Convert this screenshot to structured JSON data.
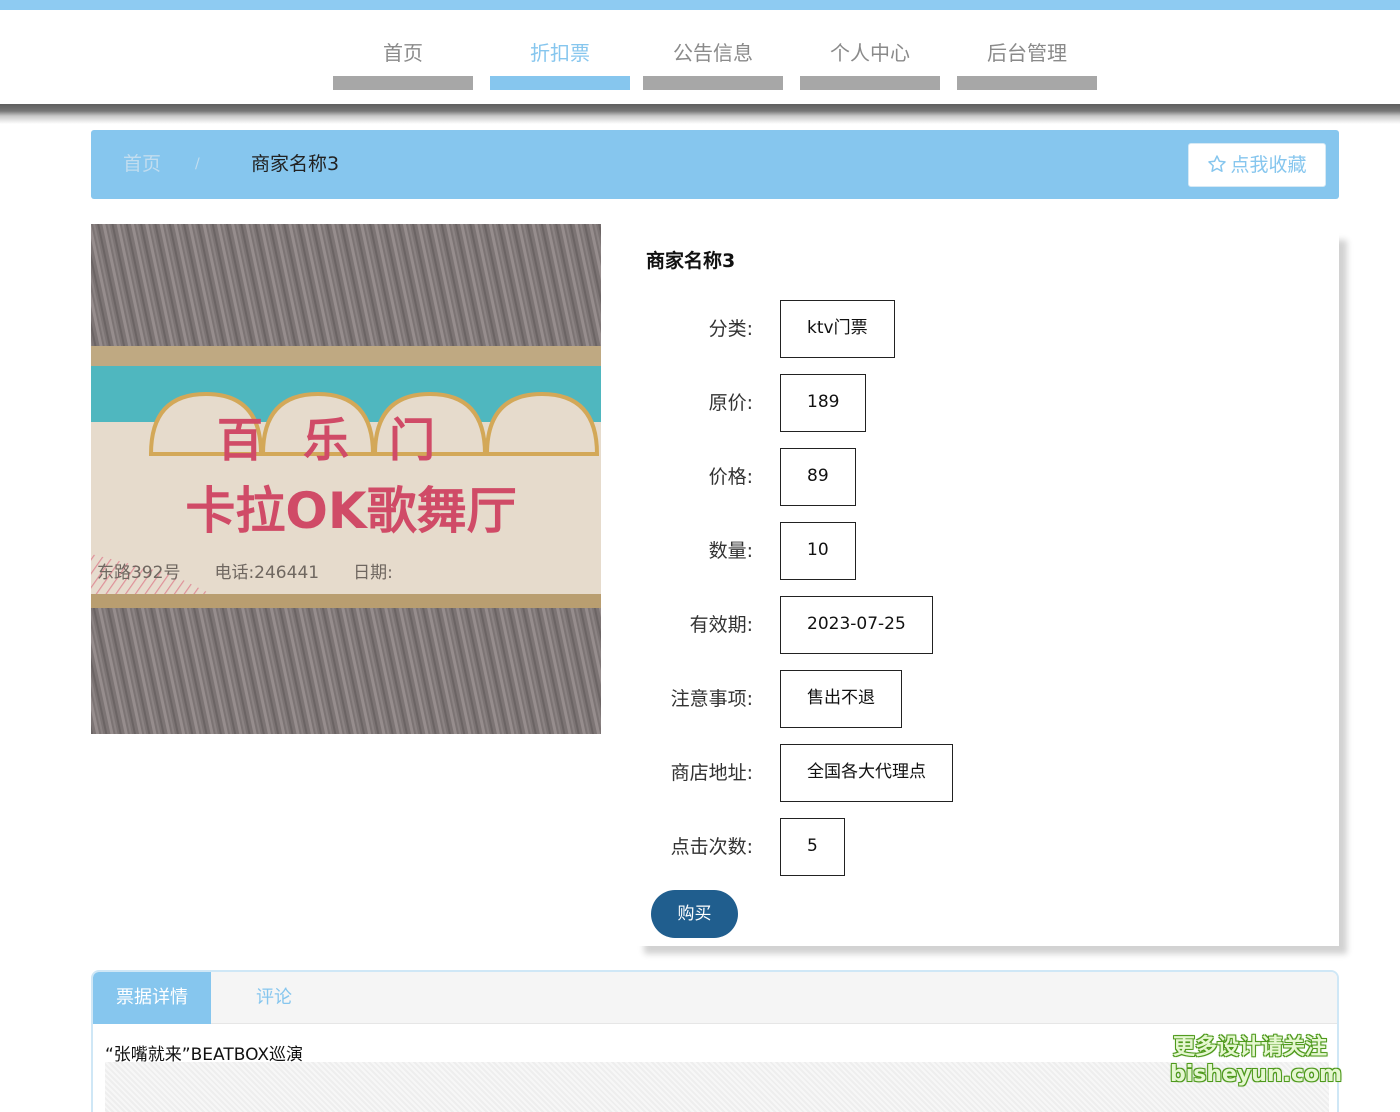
{
  "colors": {
    "accent": "#86c6ee",
    "nav_inactive": "#a7a7a7",
    "buy_button": "#205e8e"
  },
  "nav": {
    "items": [
      {
        "label": "首页"
      },
      {
        "label": "折扣票"
      },
      {
        "label": "公告信息"
      },
      {
        "label": "个人中心"
      },
      {
        "label": "后台管理"
      }
    ],
    "active": "折扣票"
  },
  "breadcrumb": {
    "home": "首页",
    "separator": "/",
    "current": "商家名称3"
  },
  "favorite_button": {
    "label": "点我收藏",
    "icon": "star-outline-icon"
  },
  "product_image": {
    "top_text": "百乐门",
    "main_text": "卡拉OK歌舞厅",
    "bottom_text": "东路392号　　电话:246441　　日期:"
  },
  "product": {
    "title": "商家名称3",
    "fields": [
      {
        "label": "分类:",
        "value": "ktv门票"
      },
      {
        "label": "原价:",
        "value": "189"
      },
      {
        "label": "价格:",
        "value": "89"
      },
      {
        "label": "数量:",
        "value": "10"
      },
      {
        "label": "有效期:",
        "value": "2023-07-25"
      },
      {
        "label": "注意事项:",
        "value": "售出不退"
      },
      {
        "label": "商店地址:",
        "value": "全国各大代理点"
      },
      {
        "label": "点击次数:",
        "value": "5"
      }
    ],
    "buy_label": "购买"
  },
  "tabs": {
    "items": [
      {
        "label": "票据详情"
      },
      {
        "label": "评论"
      }
    ],
    "active": "票据详情",
    "detail_text": "“张嘴就来”BEATBOX巡演"
  },
  "watermark": {
    "line1": "更多设计请关注",
    "line2": "bisheyun.com"
  }
}
